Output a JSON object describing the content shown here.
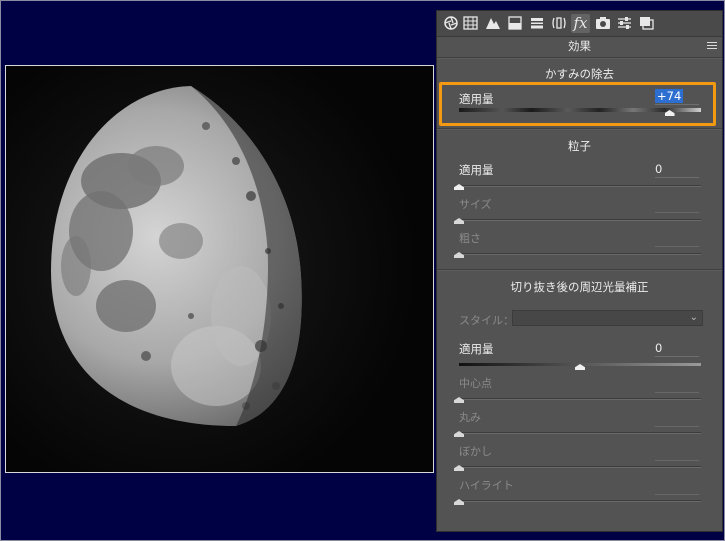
{
  "toolbar": {
    "icons": [
      "aperture-icon",
      "histogram-grid-icon",
      "mountain-icon",
      "split-toning-icon",
      "hsl-bars-icon",
      "lens-icon",
      "fx-icon",
      "camera-icon",
      "sliders-icon",
      "presets-icon"
    ],
    "active": "fx-icon",
    "fx_glyph": "fx"
  },
  "panel": {
    "title": "効果"
  },
  "dehaze": {
    "title": "かすみの除去",
    "amount_label": "適用量",
    "amount_value": "+74",
    "amount_level_pct": 87
  },
  "grain": {
    "title": "粒子",
    "amount_label": "適用量",
    "amount_value": "0",
    "amount_level_pct": 0,
    "size_label": "サイズ",
    "size_level_pct": 0,
    "roughness_label": "粗さ",
    "roughness_level_pct": 0
  },
  "vignette": {
    "title": "切り抜き後の周辺光量補正",
    "style_label": "スタイル：",
    "style_value": "",
    "amount_label": "適用量",
    "amount_value": "0",
    "amount_level_pct": 50,
    "midpoint_label": "中心点",
    "midpoint_level_pct": 0,
    "roundness_label": "丸み",
    "roundness_level_pct": 0,
    "feather_label": "ぼかし",
    "feather_level_pct": 0,
    "highlights_label": "ハイライト",
    "highlights_level_pct": 0
  },
  "colors": {
    "background": "#000044",
    "panel": "#535353",
    "accent_highlight": "#f39a12",
    "selection": "#2c6fd1"
  }
}
